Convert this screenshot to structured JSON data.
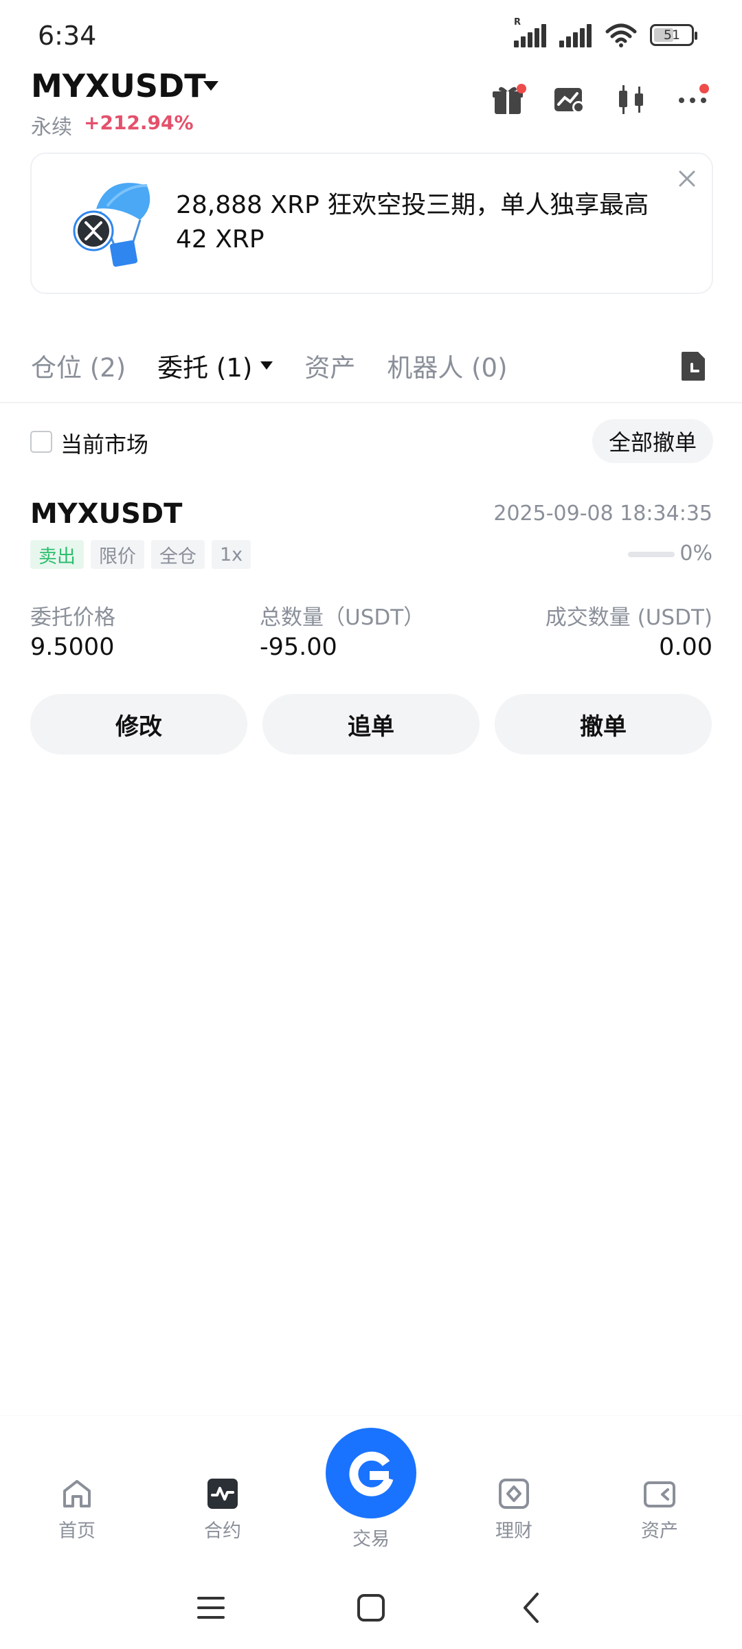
{
  "status_bar": {
    "time": "6:34",
    "battery": "51",
    "signal_label": "R"
  },
  "header": {
    "symbol": "MYXUSDT",
    "contract_type": "永续",
    "change": "+212.94%",
    "icons": [
      "gift-icon",
      "chart-settings-icon",
      "candlestick-icon",
      "more-icon"
    ]
  },
  "banner": {
    "text": "28,888 XRP 狂欢空投三期，单人独享最高 42 XRP",
    "image": "airdrop-parachute-icon"
  },
  "tabs": [
    {
      "label": "仓位 (2)"
    },
    {
      "label": "委托 (1)"
    },
    {
      "label": "资产"
    },
    {
      "label": "机器人 (0)"
    }
  ],
  "filter": {
    "current_market_label": "当前市场",
    "cancel_all_label": "全部撤单"
  },
  "order": {
    "symbol": "MYXUSDT",
    "time": "2025-09-08 18:34:35",
    "tags": [
      "卖出",
      "限价",
      "全仓",
      "1x"
    ],
    "progress": 0,
    "progress_text": "0%",
    "fields": [
      {
        "label": "委托价格",
        "value": "9.5000"
      },
      {
        "label": "总数量（USDT）",
        "value": "-95.00"
      },
      {
        "label": "成交数量 (USDT)",
        "value": "0.00"
      }
    ],
    "actions": [
      "修改",
      "追单",
      "撤单"
    ]
  },
  "bottom_nav": [
    {
      "label": "首页",
      "icon": "home-icon"
    },
    {
      "label": "合约",
      "icon": "futures-icon"
    },
    {
      "label": "交易",
      "icon": "trade-icon"
    },
    {
      "label": "理财",
      "icon": "earn-icon"
    },
    {
      "label": "资产",
      "icon": "wallet-icon"
    }
  ],
  "colors": {
    "accent": "#1a73ff",
    "positive_change": "#e4506b",
    "sell": "#2dbd6e"
  }
}
